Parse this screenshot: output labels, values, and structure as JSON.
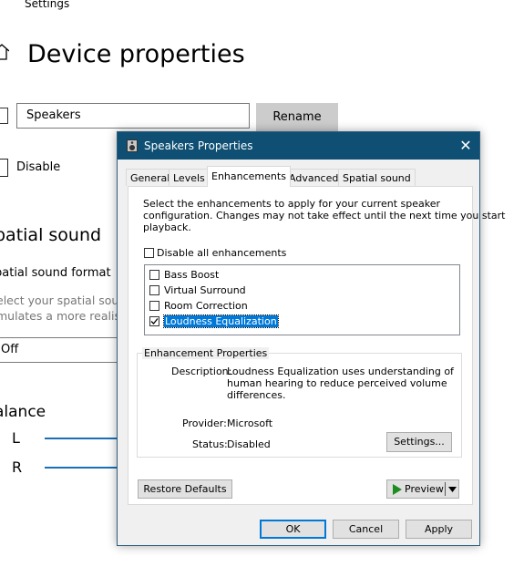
{
  "background": {
    "app_label": "Settings",
    "page_title": "Device properties",
    "device_name_value": "Speakers",
    "rename_label": "Rename",
    "disable_label": "Disable",
    "spatial_heading": "patial sound",
    "spatial_format_label": "patial sound format",
    "spatial_desc_line1": "elect your spatial sou",
    "spatial_desc_line2": "mulates a more realis",
    "spatial_format_value": "Off",
    "balance_heading": "alance",
    "balance_left": "L",
    "balance_right": "R"
  },
  "dialog": {
    "title": "Speakers Properties",
    "close_glyph": "✕",
    "tabs": [
      {
        "label": "General",
        "active": false
      },
      {
        "label": "Levels",
        "active": false
      },
      {
        "label": "Enhancements",
        "active": true
      },
      {
        "label": "Advanced",
        "active": false
      },
      {
        "label": "Spatial sound",
        "active": false
      }
    ],
    "intro_line1": "Select the enhancements to apply for your current speaker",
    "intro_line2": "configuration. Changes may not take effect until the next time you start",
    "intro_line3": "playback.",
    "disable_all_label": "Disable all enhancements",
    "enhancements": [
      {
        "label": "Bass Boost",
        "checked": false
      },
      {
        "label": "Virtual Surround",
        "checked": false
      },
      {
        "label": "Room Correction",
        "checked": false
      },
      {
        "label": "Loudness Equalization",
        "checked": true,
        "selected": true
      }
    ],
    "group_label": "Enhancement Properties",
    "description_label": "Description:",
    "description_line1": "Loudness Equalization uses understanding of",
    "description_line2": "human hearing to reduce perceived volume",
    "description_line3": "differences.",
    "provider_label": "Provider:",
    "provider_value": "Microsoft",
    "status_label": "Status:",
    "status_value": "Disabled",
    "settings_button": "Settings...",
    "restore_defaults_button": "Restore Defaults",
    "preview_button": "Preview",
    "ok_button": "OK",
    "cancel_button": "Cancel",
    "apply_button": "Apply"
  },
  "colors": {
    "titlebar": "#0e4f73",
    "accent": "#0078d7",
    "play_icon": "#1e8c1e"
  }
}
